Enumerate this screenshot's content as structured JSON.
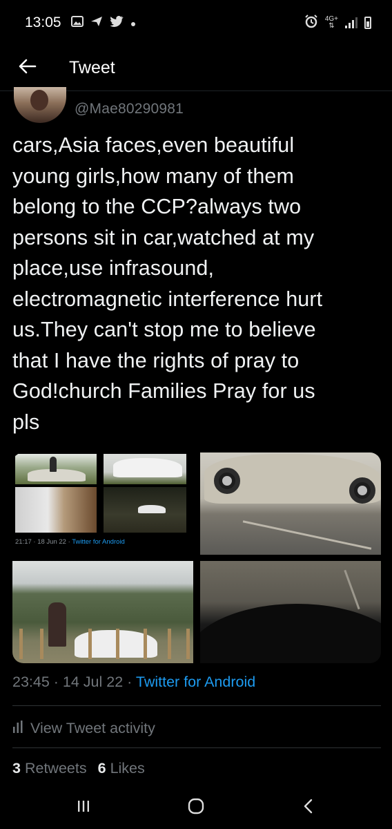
{
  "status_bar": {
    "time": "13:05",
    "network_label": "4G+",
    "icons_left": [
      "gallery-icon",
      "send-icon",
      "twitter-bird-icon",
      "dot-icon"
    ],
    "icons_right": [
      "alarm-icon",
      "network-4g-icon",
      "signal-icon",
      "battery-icon"
    ]
  },
  "header": {
    "title": "Tweet",
    "back_icon": "arrow-left-icon"
  },
  "tweet": {
    "handle": "@Mae80290981",
    "lines": [
      "cars,Asia faces,even beautiful",
      "young girls,how many of them",
      "belong to the CCP?always two",
      "persons sit in car,watched at my",
      "place,use infrasound,",
      "electromagnetic interference hurt",
      "us.They can't stop me to believe",
      "that I have the rights of pray to",
      "God!church Families Pray for us",
      "pls"
    ],
    "media": {
      "count": 4,
      "embedded_meta": {
        "time": "21:17 · 18 Jun 22 · ",
        "app": "Twitter for Android"
      }
    },
    "timestamp": {
      "time": "23:45",
      "separator1": " · ",
      "date": "14 Jul 22",
      "separator2": " · ",
      "app": "Twitter for Android"
    },
    "activity": {
      "label": "View Tweet activity",
      "icon": "bar-chart-icon"
    },
    "stats": {
      "retweets_count": "3",
      "retweets_label": "Retweets",
      "likes_count": "6",
      "likes_label": "Likes"
    }
  },
  "system_nav": {
    "recents_icon": "recents-icon",
    "home_icon": "home-icon",
    "back_icon": "back-chevron-icon"
  },
  "colors": {
    "background": "#000000",
    "text_primary": "#e7e9ea",
    "text_secondary": "#71767b",
    "link": "#1d9bf0",
    "divider": "#2f3336"
  }
}
